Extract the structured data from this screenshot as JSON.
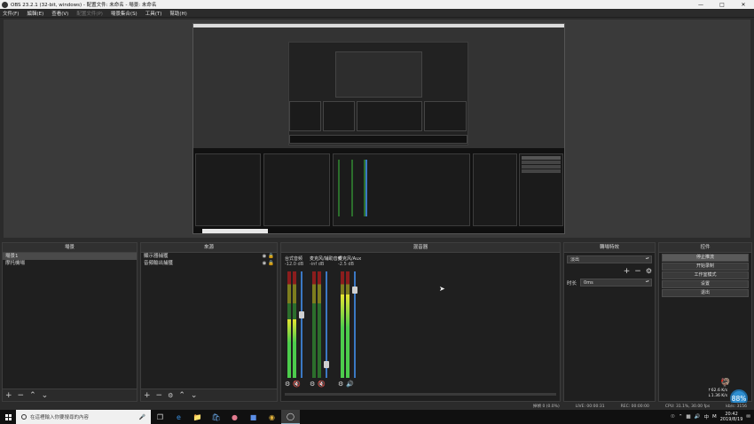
{
  "window": {
    "title": "OBS 23.2.1 (32-bit, windows) - 配置文件: 未命名 - 場景: 未命名",
    "min_icon": "minimize-icon",
    "max_icon": "maximize-icon",
    "close_icon": "close-icon"
  },
  "menu": [
    "文件(F)",
    "編輯(E)",
    "查看(V)",
    "配置文件(P)",
    "場景集合(S)",
    "工具(T)",
    "幫助(H)"
  ],
  "menu_disabled": "配置文件(P)",
  "scenes": {
    "header": "場景",
    "items": [
      "場景1",
      "摩托機場"
    ],
    "selected_index": 0
  },
  "sources": {
    "header": "來源",
    "items": [
      "顯示器捕獲",
      "音頻輸出捕獲"
    ]
  },
  "mixer": {
    "header": "混音器",
    "channels": [
      {
        "name": "台式音频",
        "db": "-12.0 dB",
        "level": 0.55,
        "fader": 0.6,
        "muted": true
      },
      {
        "name": "麦克风/辅助音频",
        "db": "-inf dB",
        "level": 0.0,
        "fader": 0.1,
        "muted": true
      },
      {
        "name": "麦克风/Aux",
        "db": "-2.5 dB",
        "level": 0.78,
        "fader": 0.85,
        "muted": false
      }
    ]
  },
  "transitions": {
    "header": "轉場特效",
    "type": "淡出",
    "duration_label": "时长",
    "duration_value": "0ms"
  },
  "controls": {
    "header": "控件",
    "buttons": [
      "停止推流",
      "开始录制",
      "工作室模式",
      "设置",
      "退出"
    ],
    "active_index": 0
  },
  "status": {
    "dropped": "掉幀 0 (0.0%)",
    "live": "LIVE: 00:00:31",
    "rec": "REC: 00:00:00",
    "cpu": "CPU: 31.1%, 30.00 fps",
    "bitrate": "kb/s: 3156"
  },
  "taskbar": {
    "search_placeholder": "在這裡輸入你要搜尋的內容",
    "time": "20:42",
    "date": "2019/8/19",
    "ime": "M",
    "ime2": "中",
    "notification_icon": "notification-icon"
  },
  "netwidget": {
    "up": "62.6 K/s",
    "down": "1.36 K/s",
    "percent": "88%"
  },
  "colors": {
    "accent": "#3b78c4",
    "muted": "#e03b3b",
    "meter_green": "#4ccc4c",
    "meter_yellow": "#e5e531"
  }
}
